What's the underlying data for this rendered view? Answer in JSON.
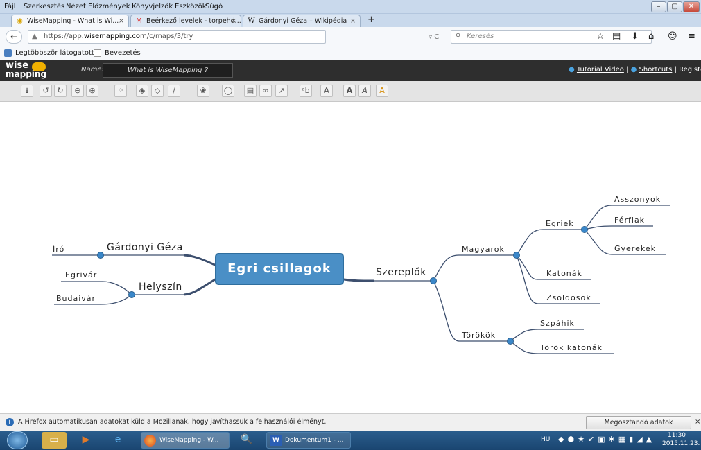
{
  "menu": [
    "Fájl",
    "Szerkesztés",
    "Nézet",
    "Előzmények",
    "Könyvjelzők",
    "Eszközök",
    "Súgó"
  ],
  "window_controls": {
    "minimize": "–",
    "maximize": "▢",
    "close": "✕"
  },
  "tabs": [
    {
      "label": "WiseMapping - What is Wi...",
      "close": "×"
    },
    {
      "label": "Beérkező levelek - torpehd...",
      "close": "×"
    },
    {
      "label": "Gárdonyi Géza – Wikipédia",
      "close": "×"
    }
  ],
  "new_tab": "+",
  "nav": {
    "back": "←",
    "url_prefix": "https://app.",
    "url_domain": "wisemapping.com",
    "url_path": "/c/maps/3/try",
    "reload": "▿ C",
    "search_placeholder": "Keresés"
  },
  "nav_icons": [
    "☆",
    "▤",
    "⬇",
    "⌂",
    "☺",
    "≡"
  ],
  "bookmarks": [
    "Legtöbbször látogatott",
    "Bevezetés"
  ],
  "app": {
    "logo_top": "wise",
    "logo_bottom": "mapping",
    "name_label": "Name:",
    "map_name": "What is WiseMapping ?",
    "tutorial": "Tutorial Video",
    "sep1": "|",
    "shortcuts": "Shortcuts",
    "sep2": "|",
    "register": "Registe"
  },
  "toolbar_icons": [
    "save-icon",
    "undo-icon",
    "redo-icon",
    "zoom-out-icon",
    "zoom-in-icon",
    "add-topic-icon",
    "add-child-icon",
    "delete-icon",
    "border-color-icon",
    "fill-color-icon",
    "shape-icon",
    "note-icon",
    "link-icon",
    "relationship-icon",
    "font-size-icon",
    "font-icon",
    "bold-icon",
    "italic-icon",
    "font-color-icon"
  ],
  "mindmap": {
    "central": "Egri csillagok",
    "nodes": {
      "gardonyi": "Gárdonyi Géza",
      "iro": "Író",
      "helyszin": "Helyszín",
      "egrivar": "Egrivár",
      "budaivar": "Budaivár",
      "szereplok": "Szereplők",
      "magyarok": "Magyarok",
      "egriek": "Egriek",
      "asszonyok": "Asszonyok",
      "ferfiak": "Férfiak",
      "gyerekek": "Gyerekek",
      "katonak": "Katonák",
      "zsoldosok": "Zsoldosok",
      "torokok": "Törökök",
      "szpahik": "Szpáhik",
      "torok_katonak": "Török katonák"
    }
  },
  "notification": {
    "text": "A Firefox automatikusan adatokat küld a Mozillanak, hogy javíthassuk a felhasználói élményt.",
    "button": "Megosztandó adatok kiválasztása",
    "close": "×"
  },
  "taskbar": {
    "items": [
      {
        "label": "WiseMapping - W..."
      },
      {
        "label": "Dokumentum1 - ..."
      }
    ],
    "lang": "HU",
    "time": "11:30",
    "date": "2015.11.23."
  },
  "colors": {
    "central_fill": "#4a8fc6",
    "central_border": "#2f6e9e",
    "connector": "#3d4f6e",
    "node_dot": "#3a87c9",
    "app_header": "#2e2e2e"
  }
}
